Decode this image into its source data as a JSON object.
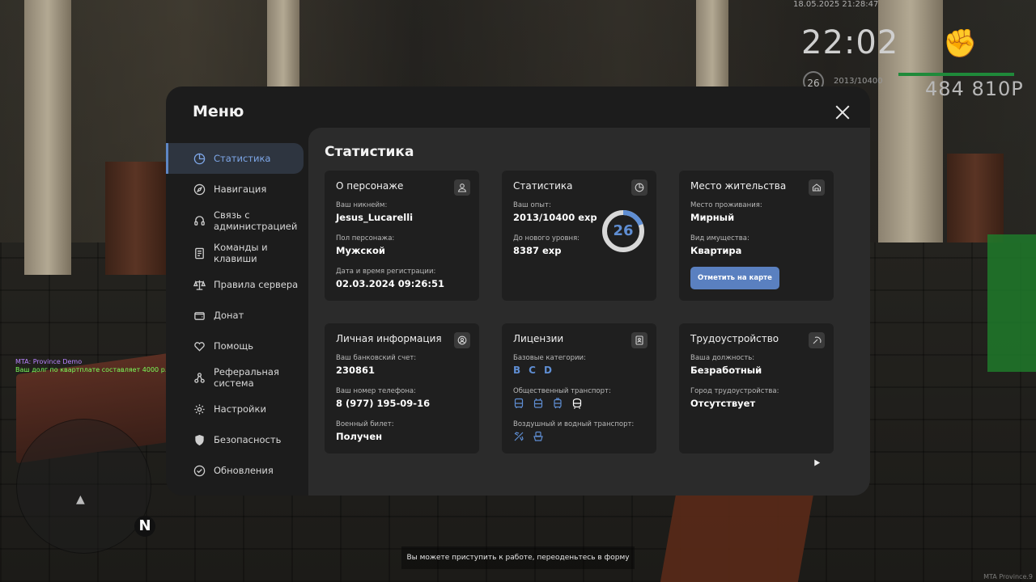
{
  "hud": {
    "datetime": "18.05.2025 21:28:47",
    "time": "22:02",
    "level": "26",
    "exp": "2013/10400",
    "money": "484 810Р"
  },
  "chat": {
    "line1": "MTA: Province Demo",
    "line2": "Ваш долг по квартплате составляет 4000 р."
  },
  "bottom_hint": "Вы можете приступить к работе, переоденьтесь в форму",
  "watermark": "MTA Province.9",
  "menu": {
    "title": "Меню",
    "sidebar": [
      {
        "label": "Статистика",
        "icon": "pie-chart-icon",
        "active": true
      },
      {
        "label": "Навигация",
        "icon": "compass-icon"
      },
      {
        "label": "Связь с\nадминистрацией",
        "icon": "headset-icon"
      },
      {
        "label": "Команды и\nклавиши",
        "icon": "document-icon"
      },
      {
        "label": "Правила сервера",
        "icon": "scales-icon"
      },
      {
        "label": "Донат",
        "icon": "wallet-icon"
      },
      {
        "label": "Помощь",
        "icon": "heart-hand-icon"
      },
      {
        "label": "Реферальная\nсистема",
        "icon": "network-icon"
      },
      {
        "label": "Настройки",
        "icon": "gear-icon"
      },
      {
        "label": "Безопасность",
        "icon": "shield-icon"
      },
      {
        "label": "Обновления",
        "icon": "check-circle-icon"
      }
    ],
    "content_title": "Статистика",
    "cards": {
      "character": {
        "title": "О персонаже",
        "nickname_label": "Ваш никнейм:",
        "nickname": "Jesus_Lucarelli",
        "gender_label": "Пол персонажа:",
        "gender": "Мужской",
        "reg_label": "Дата и время регистрации:",
        "reg": "02.03.2024 09:26:51"
      },
      "stats": {
        "title": "Статистика",
        "exp_label": "Ваш опыт:",
        "exp": "2013/10400 exp",
        "next_label": "До нового уровня:",
        "next": "8387 exp",
        "level": "26",
        "progress": 0.1935
      },
      "residence": {
        "title": "Место жительства",
        "place_label": "Место проживания:",
        "place": "Мирный",
        "property_label": "Вид имущества:",
        "property": "Квартира",
        "button": "Отметить на карте"
      },
      "personal": {
        "title": "Личная информация",
        "bank_label": "Ваш банковский счет:",
        "bank": "230861",
        "phone_label": "Ваш номер телефона:",
        "phone": "8 (977) 195-09-16",
        "military_label": "Военный билет:",
        "military": "Получен"
      },
      "licenses": {
        "title": "Лицензии",
        "base_label": "Базовые категории:",
        "categories": [
          "B",
          "C",
          "D"
        ],
        "public_label": "Общественный транспорт:",
        "air_label": "Воздушный и водный транспорт:"
      },
      "employment": {
        "title": "Трудоустройство",
        "position_label": "Ваша должность:",
        "position": "Безработный",
        "city_label": "Город трудоустройства:",
        "city": "Отсутствует"
      }
    }
  },
  "colors": {
    "accent": "#5f8ed3",
    "button": "#5a80c0",
    "card": "#1f1f1f",
    "panel": "#2b2b2b",
    "window": "#1c1c1c"
  }
}
